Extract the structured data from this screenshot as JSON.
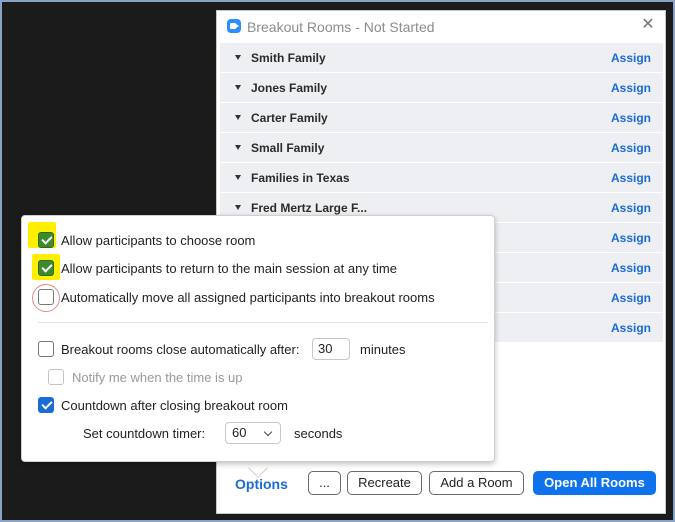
{
  "window": {
    "title": "Breakout Rooms - Not Started",
    "close_glyph": "✕"
  },
  "rooms": [
    {
      "name": "Smith Family",
      "action": "Assign"
    },
    {
      "name": "Jones Family",
      "action": "Assign"
    },
    {
      "name": "Carter Family",
      "action": "Assign"
    },
    {
      "name": "Small Family",
      "action": "Assign"
    },
    {
      "name": "Families in Texas",
      "action": "Assign"
    },
    {
      "name": "Fred Mertz Large F...",
      "action": "Assign"
    },
    {
      "name": "",
      "action": "Assign"
    },
    {
      "name": "",
      "action": "Assign"
    },
    {
      "name": "",
      "action": "Assign"
    },
    {
      "name": "",
      "action": "Assign"
    }
  ],
  "options": {
    "choose_room": {
      "label": "Allow participants to choose room",
      "checked": true
    },
    "return_main": {
      "label": "Allow participants to return to the main session at any time",
      "checked": true
    },
    "auto_move": {
      "label": "Automatically move all assigned participants into breakout rooms",
      "checked": false
    },
    "auto_close": {
      "label": "Breakout rooms close automatically after:",
      "checked": false,
      "value": "30",
      "unit": "minutes"
    },
    "notify": {
      "label": "Notify me when the time is up",
      "checked": false
    },
    "countdown": {
      "label": "Countdown after closing breakout room",
      "checked": true
    },
    "timer": {
      "label": "Set countdown timer:",
      "value": "60",
      "unit": "seconds"
    }
  },
  "bottom_bar": {
    "options_label": "Options",
    "more_label": "...",
    "recreate_label": "Recreate",
    "add_room_label": "Add a Room",
    "open_all_label": "Open All Rooms"
  },
  "colors": {
    "accent": "#0e72ed",
    "link": "#1a6bd6",
    "highlight": "#ffee00",
    "room_bg": "#eeeff2"
  }
}
